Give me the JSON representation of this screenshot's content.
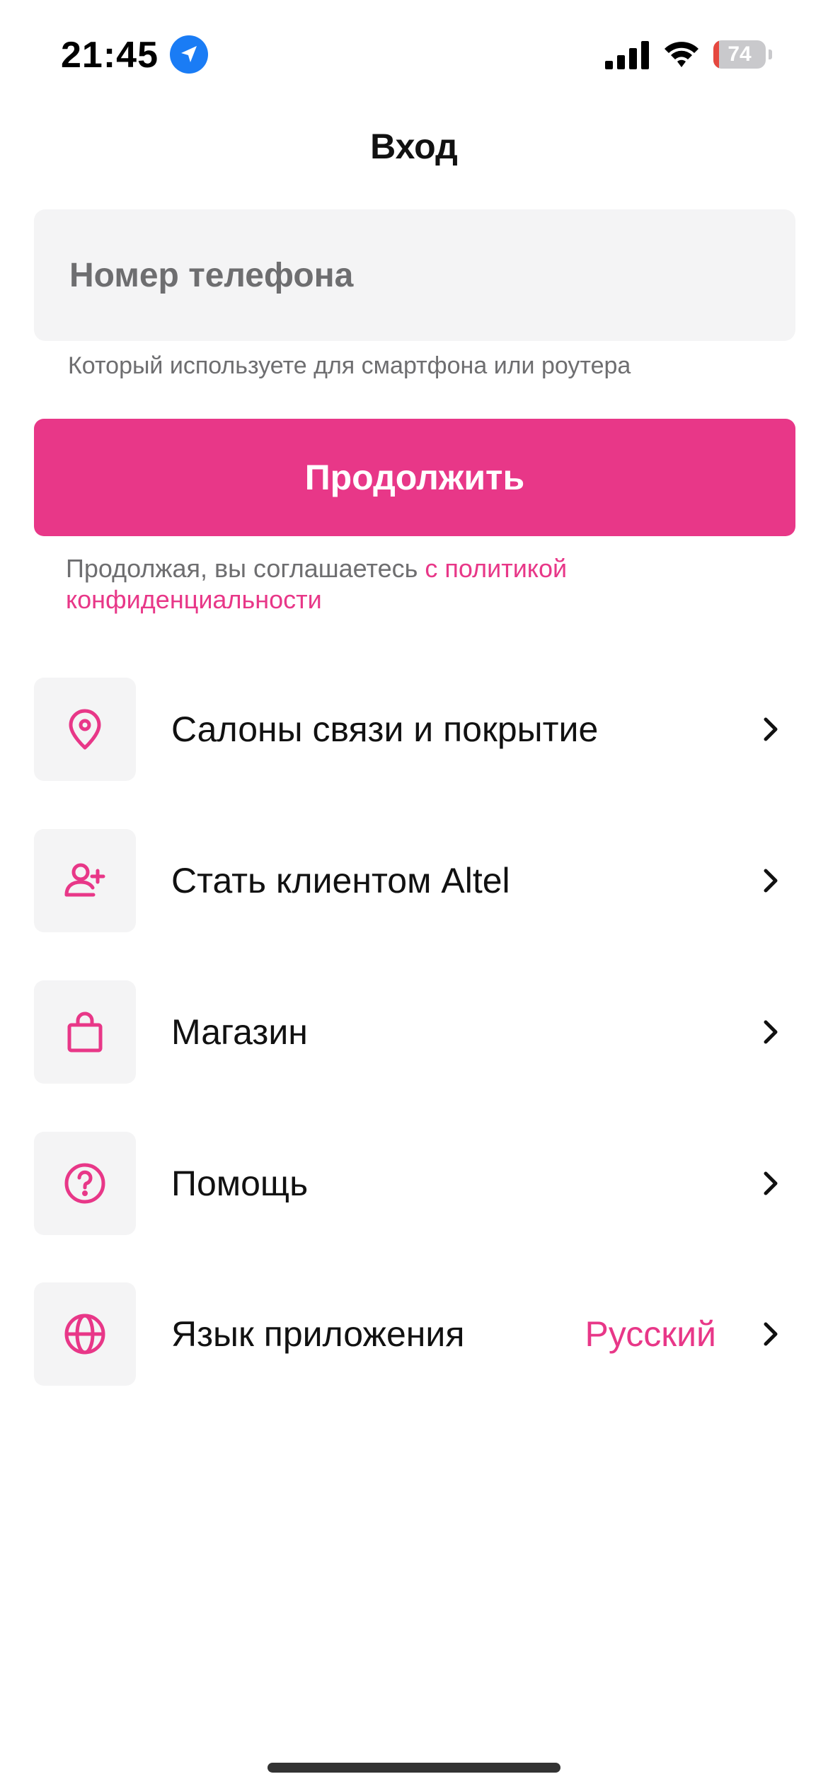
{
  "status_bar": {
    "time": "21:45",
    "battery_level": "74",
    "icons": [
      "location-arrow-icon",
      "cellular-signal-icon",
      "wifi-icon",
      "battery-icon"
    ]
  },
  "header": {
    "title": "Вход"
  },
  "login": {
    "phone_placeholder": "Номер телефона",
    "phone_hint": "Который используете для смартфона или роутера",
    "continue_label": "Продолжить",
    "policy_prefix": "Продолжая, вы соглашаетесь ",
    "policy_link": "с политикой конфиденциальности"
  },
  "menu": {
    "items": [
      {
        "label": "Салоны связи и покрытие",
        "icon": "map-pin-icon"
      },
      {
        "label": "Стать клиентом Altel",
        "icon": "add-user-icon"
      },
      {
        "label": "Магазин",
        "icon": "shopping-bag-icon"
      },
      {
        "label": "Помощь",
        "icon": "help-circle-icon"
      },
      {
        "label": "Язык приложения",
        "value": "Русский",
        "icon": "globe-icon"
      }
    ]
  },
  "colors": {
    "accent": "#e83788",
    "field_background": "#f4f4f5",
    "hint_text": "#6e6e70"
  }
}
